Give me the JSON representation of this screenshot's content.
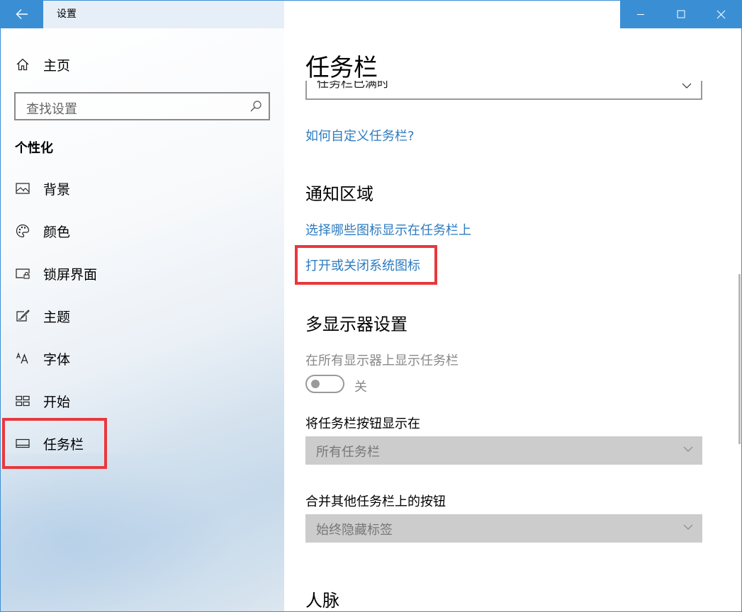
{
  "window": {
    "title": "设置",
    "accent": "#3a8fd4",
    "back_icon": "back-arrow-icon",
    "controls": [
      "minimize-icon",
      "maximize-icon",
      "close-icon"
    ]
  },
  "sidebar": {
    "home_label": "主页",
    "search_placeholder": "查找设置",
    "section": "个性化",
    "items": [
      {
        "label": "背景",
        "icon": "picture-icon"
      },
      {
        "label": "颜色",
        "icon": "palette-icon"
      },
      {
        "label": "锁屏界面",
        "icon": "lock-screen-icon"
      },
      {
        "label": "主题",
        "icon": "theme-brush-icon"
      },
      {
        "label": "字体",
        "icon": "font-icon"
      },
      {
        "label": "开始",
        "icon": "start-tiles-icon"
      },
      {
        "label": "任务栏",
        "icon": "taskbar-icon"
      }
    ],
    "selected": "任务栏"
  },
  "main": {
    "page_title": "任务栏",
    "top_dropdown_partial": "任务栏已满时",
    "link_customize": "如何自定义任务栏?",
    "notify_heading": "通知区域",
    "link_select_icons": "选择哪些图标显示在任务栏上",
    "link_system_icons": "打开或关闭系统图标",
    "multi_heading": "多显示器设置",
    "show_all_label": "在所有显示器上显示任务栏",
    "toggle_state": "关",
    "buttons_on_label": "将任务栏按钮显示在",
    "buttons_on_value": "所有任务栏",
    "combine_label": "合并其他任务栏上的按钮",
    "combine_value": "始终隐藏标签",
    "people_heading": "人脉",
    "link_color": "#2d7bbf",
    "highlight_color": "#e8383d"
  }
}
